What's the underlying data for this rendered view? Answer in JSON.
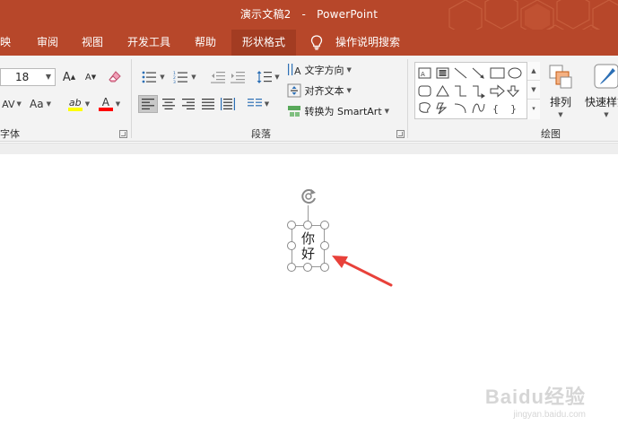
{
  "title": {
    "document": "演示文稿2",
    "separator": "-",
    "app": "PowerPoint"
  },
  "tabs": [
    {
      "label": "映",
      "active": false
    },
    {
      "label": "审阅",
      "active": false
    },
    {
      "label": "视图",
      "active": false
    },
    {
      "label": "开发工具",
      "active": false
    },
    {
      "label": "帮助",
      "active": false
    },
    {
      "label": "形状格式",
      "active": true
    }
  ],
  "tell_me": "操作说明搜索",
  "font_group": {
    "label": "字体",
    "font_size": "18",
    "grow_label": "A",
    "shrink_label": "A",
    "char_spacing_label": "AV",
    "change_case_label": "Aa",
    "highlight_label": "ab",
    "font_color_label": "A"
  },
  "paragraph_group": {
    "label": "段落",
    "text_direction": "文字方向",
    "align_text": "对齐文本",
    "convert_smartart": "转换为 SmartArt"
  },
  "drawing_group": {
    "label": "绘图",
    "arrange": "排列",
    "quick_styles": "快速样式"
  },
  "slide": {
    "text_line1": "你",
    "text_line2": "好"
  },
  "watermark": {
    "brand": "Baidu经验",
    "url": "jingyan.baidu.com"
  },
  "colors": {
    "accent": "#b7472a",
    "active_tab": "#a33c22",
    "highlight_yellow": "#ffff00",
    "font_red": "#ff0000",
    "arrow_red": "#e8413a"
  }
}
